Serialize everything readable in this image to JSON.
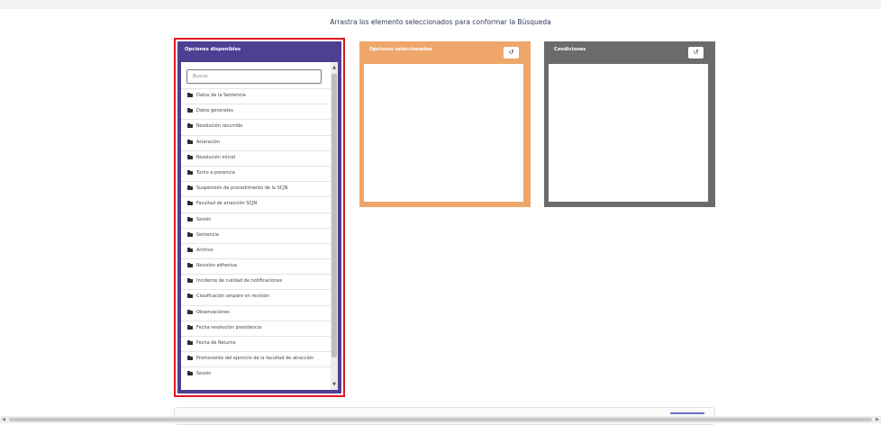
{
  "instruction": "Arrastra los elemento seleccionados para conformar la Búsqueda",
  "available": {
    "title": "Opciones disponibles",
    "search_placeholder": "Buscar",
    "items": [
      {
        "label": "Datos de la Sentencia"
      },
      {
        "label": "Datos generales"
      },
      {
        "label": "Resolución recurrida"
      },
      {
        "label": "Aclaración"
      },
      {
        "label": "Resolución inicial"
      },
      {
        "label": "Turno a ponencia"
      },
      {
        "label": "Suspensión de procedimiento de la SCJN"
      },
      {
        "label": "Facultad de atracción SCJN"
      },
      {
        "label": "Sesión"
      },
      {
        "label": "Sentencia"
      },
      {
        "label": "Archivo"
      },
      {
        "label": "Revisión adhesiva"
      },
      {
        "label": "Incidente de nulidad de notificaciones"
      },
      {
        "label": "Clasificación amparo en revisión"
      },
      {
        "label": "Observaciones"
      },
      {
        "label": "Fecha resolución presidencia"
      },
      {
        "label": "Fecha de Returno"
      },
      {
        "label": "Promovente del ejercicio de la facultad de atracción"
      },
      {
        "label": "Sesión"
      }
    ],
    "icon": "folder-icon"
  },
  "selected": {
    "title": "Opciones seleccionadas",
    "reset_icon": "↺"
  },
  "conditions": {
    "title": "Condiciones",
    "reset_icon": "↺"
  },
  "scroll": {
    "up": "▲",
    "down": "▼",
    "left": "◀",
    "right": "▶"
  },
  "colors": {
    "available_header": "#4e3f92",
    "selected_header": "#efa66a",
    "conditions_header": "#6b6b6b",
    "highlight_border": "#e0161f"
  }
}
